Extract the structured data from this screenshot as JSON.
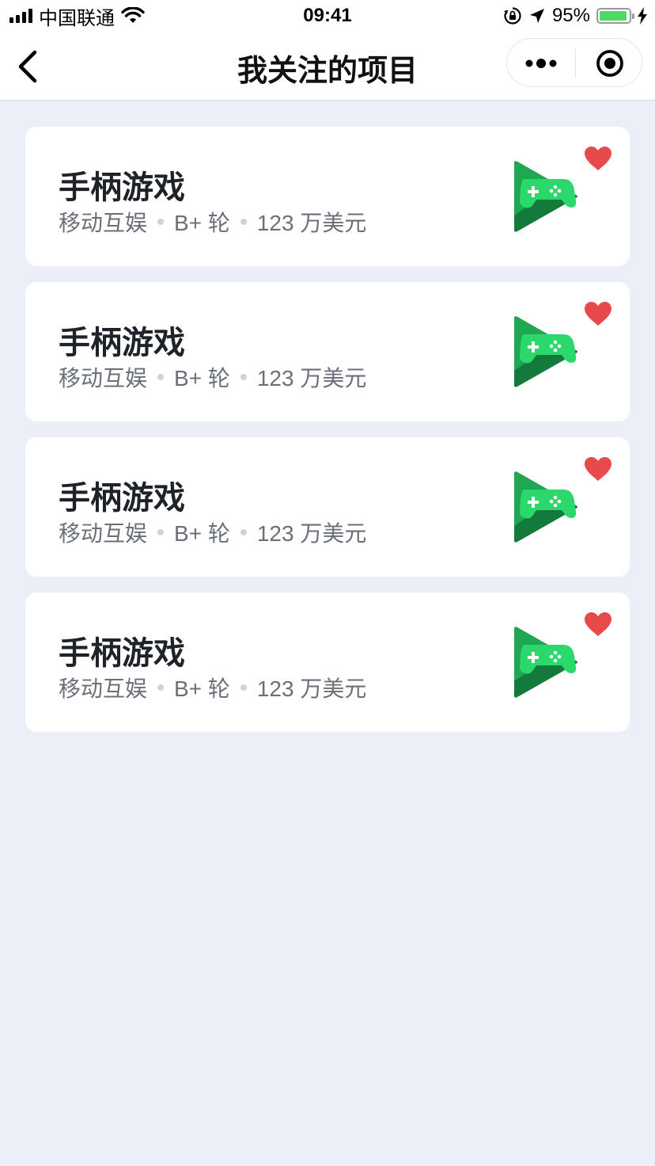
{
  "status": {
    "carrier": "中国联通",
    "time": "09:41",
    "battery": "95%",
    "battery_level": 0.95
  },
  "nav": {
    "title": "我关注的项目"
  },
  "colors": {
    "background": "#ECEFF7",
    "heart": "#E8494B",
    "logo_green": "#2BD86B",
    "logo_dark": "#147A3B"
  },
  "projects": [
    {
      "title": "手柄游戏",
      "category": "移动互娱",
      "round": "B+ 轮",
      "amount": "123 万美元",
      "icon": "game-controller-play-logo",
      "favorited": true
    },
    {
      "title": "手柄游戏",
      "category": "移动互娱",
      "round": "B+ 轮",
      "amount": "123 万美元",
      "icon": "game-controller-play-logo",
      "favorited": true
    },
    {
      "title": "手柄游戏",
      "category": "移动互娱",
      "round": "B+ 轮",
      "amount": "123 万美元",
      "icon": "game-controller-play-logo",
      "favorited": true
    },
    {
      "title": "手柄游戏",
      "category": "移动互娱",
      "round": "B+ 轮",
      "amount": "123 万美元",
      "icon": "game-controller-play-logo",
      "favorited": true
    }
  ]
}
